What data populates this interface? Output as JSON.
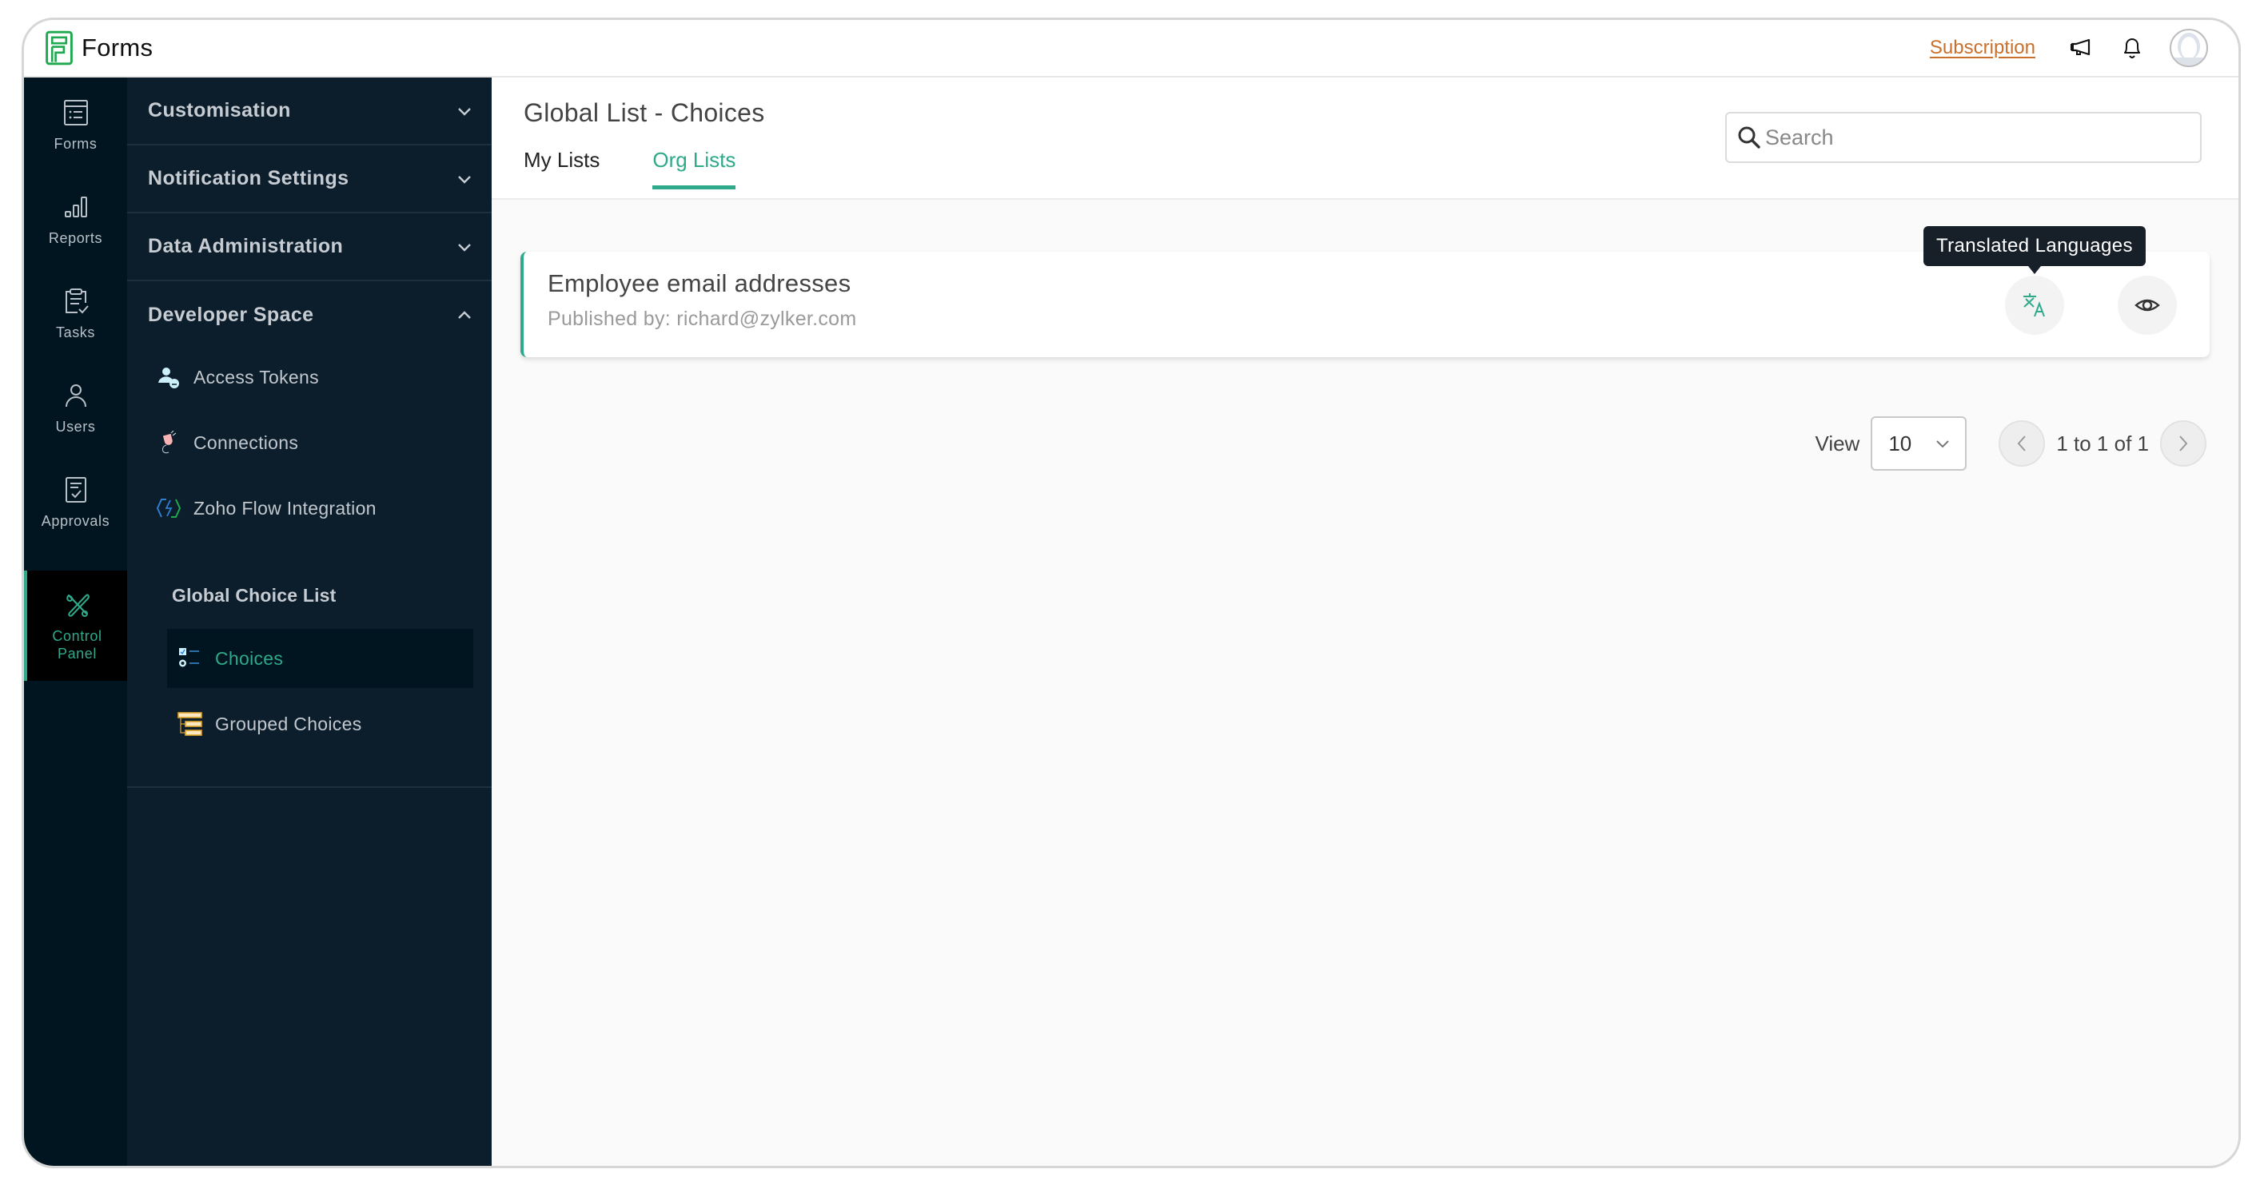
{
  "app": {
    "name": "Forms",
    "subscription_label": "Subscription",
    "icons": {
      "announcements": "megaphone-icon",
      "notifications": "bell-icon",
      "profile": "avatar-icon"
    }
  },
  "rail": {
    "items": [
      {
        "label": "Forms",
        "icon": "forms-icon",
        "active": false
      },
      {
        "label": "Reports",
        "icon": "bar-chart-icon",
        "active": false
      },
      {
        "label": "Tasks",
        "icon": "clipboard-check-icon",
        "active": false
      },
      {
        "label": "Users",
        "icon": "user-icon",
        "active": false
      },
      {
        "label": "Approvals",
        "icon": "approval-doc-icon",
        "active": false
      },
      {
        "label_line1": "Control",
        "label_line2": "Panel",
        "icon": "tools-icon",
        "active": true
      }
    ]
  },
  "subnav": {
    "sections": [
      {
        "label": "Customisation",
        "expanded": false
      },
      {
        "label": "Notification Settings",
        "expanded": false
      },
      {
        "label": "Data Administration",
        "expanded": false
      },
      {
        "label": "Developer Space",
        "expanded": true
      }
    ],
    "developer_items": [
      {
        "label": "Access Tokens",
        "icon": "user-token-icon"
      },
      {
        "label": "Connections",
        "icon": "plug-icon"
      },
      {
        "label": "Zoho Flow Integration",
        "icon": "flow-icon"
      }
    ],
    "group_title": "Global Choice List",
    "group_items": [
      {
        "label": "Choices",
        "icon": "choices-list-icon",
        "active": true
      },
      {
        "label": "Grouped Choices",
        "icon": "grouped-list-icon",
        "active": false
      }
    ]
  },
  "main": {
    "title": "Global List - Choices",
    "tabs": [
      {
        "label": "My Lists",
        "active": false
      },
      {
        "label": "Org Lists",
        "active": true
      }
    ],
    "search": {
      "placeholder": "Search",
      "value": ""
    },
    "lists": [
      {
        "title": "Employee email addresses",
        "published_by": "Published by: richard@zylker.com"
      }
    ],
    "tooltip": "Translated Languages",
    "pagination": {
      "view_label": "View",
      "page_size": "10",
      "range_text": "1 to 1 of 1"
    }
  },
  "colors": {
    "accent": "#2eaa8a",
    "subscription": "#c8702c",
    "rail_bg": "#001520",
    "subnav_bg": "#0c1e2c",
    "tooltip_bg": "#172029"
  }
}
